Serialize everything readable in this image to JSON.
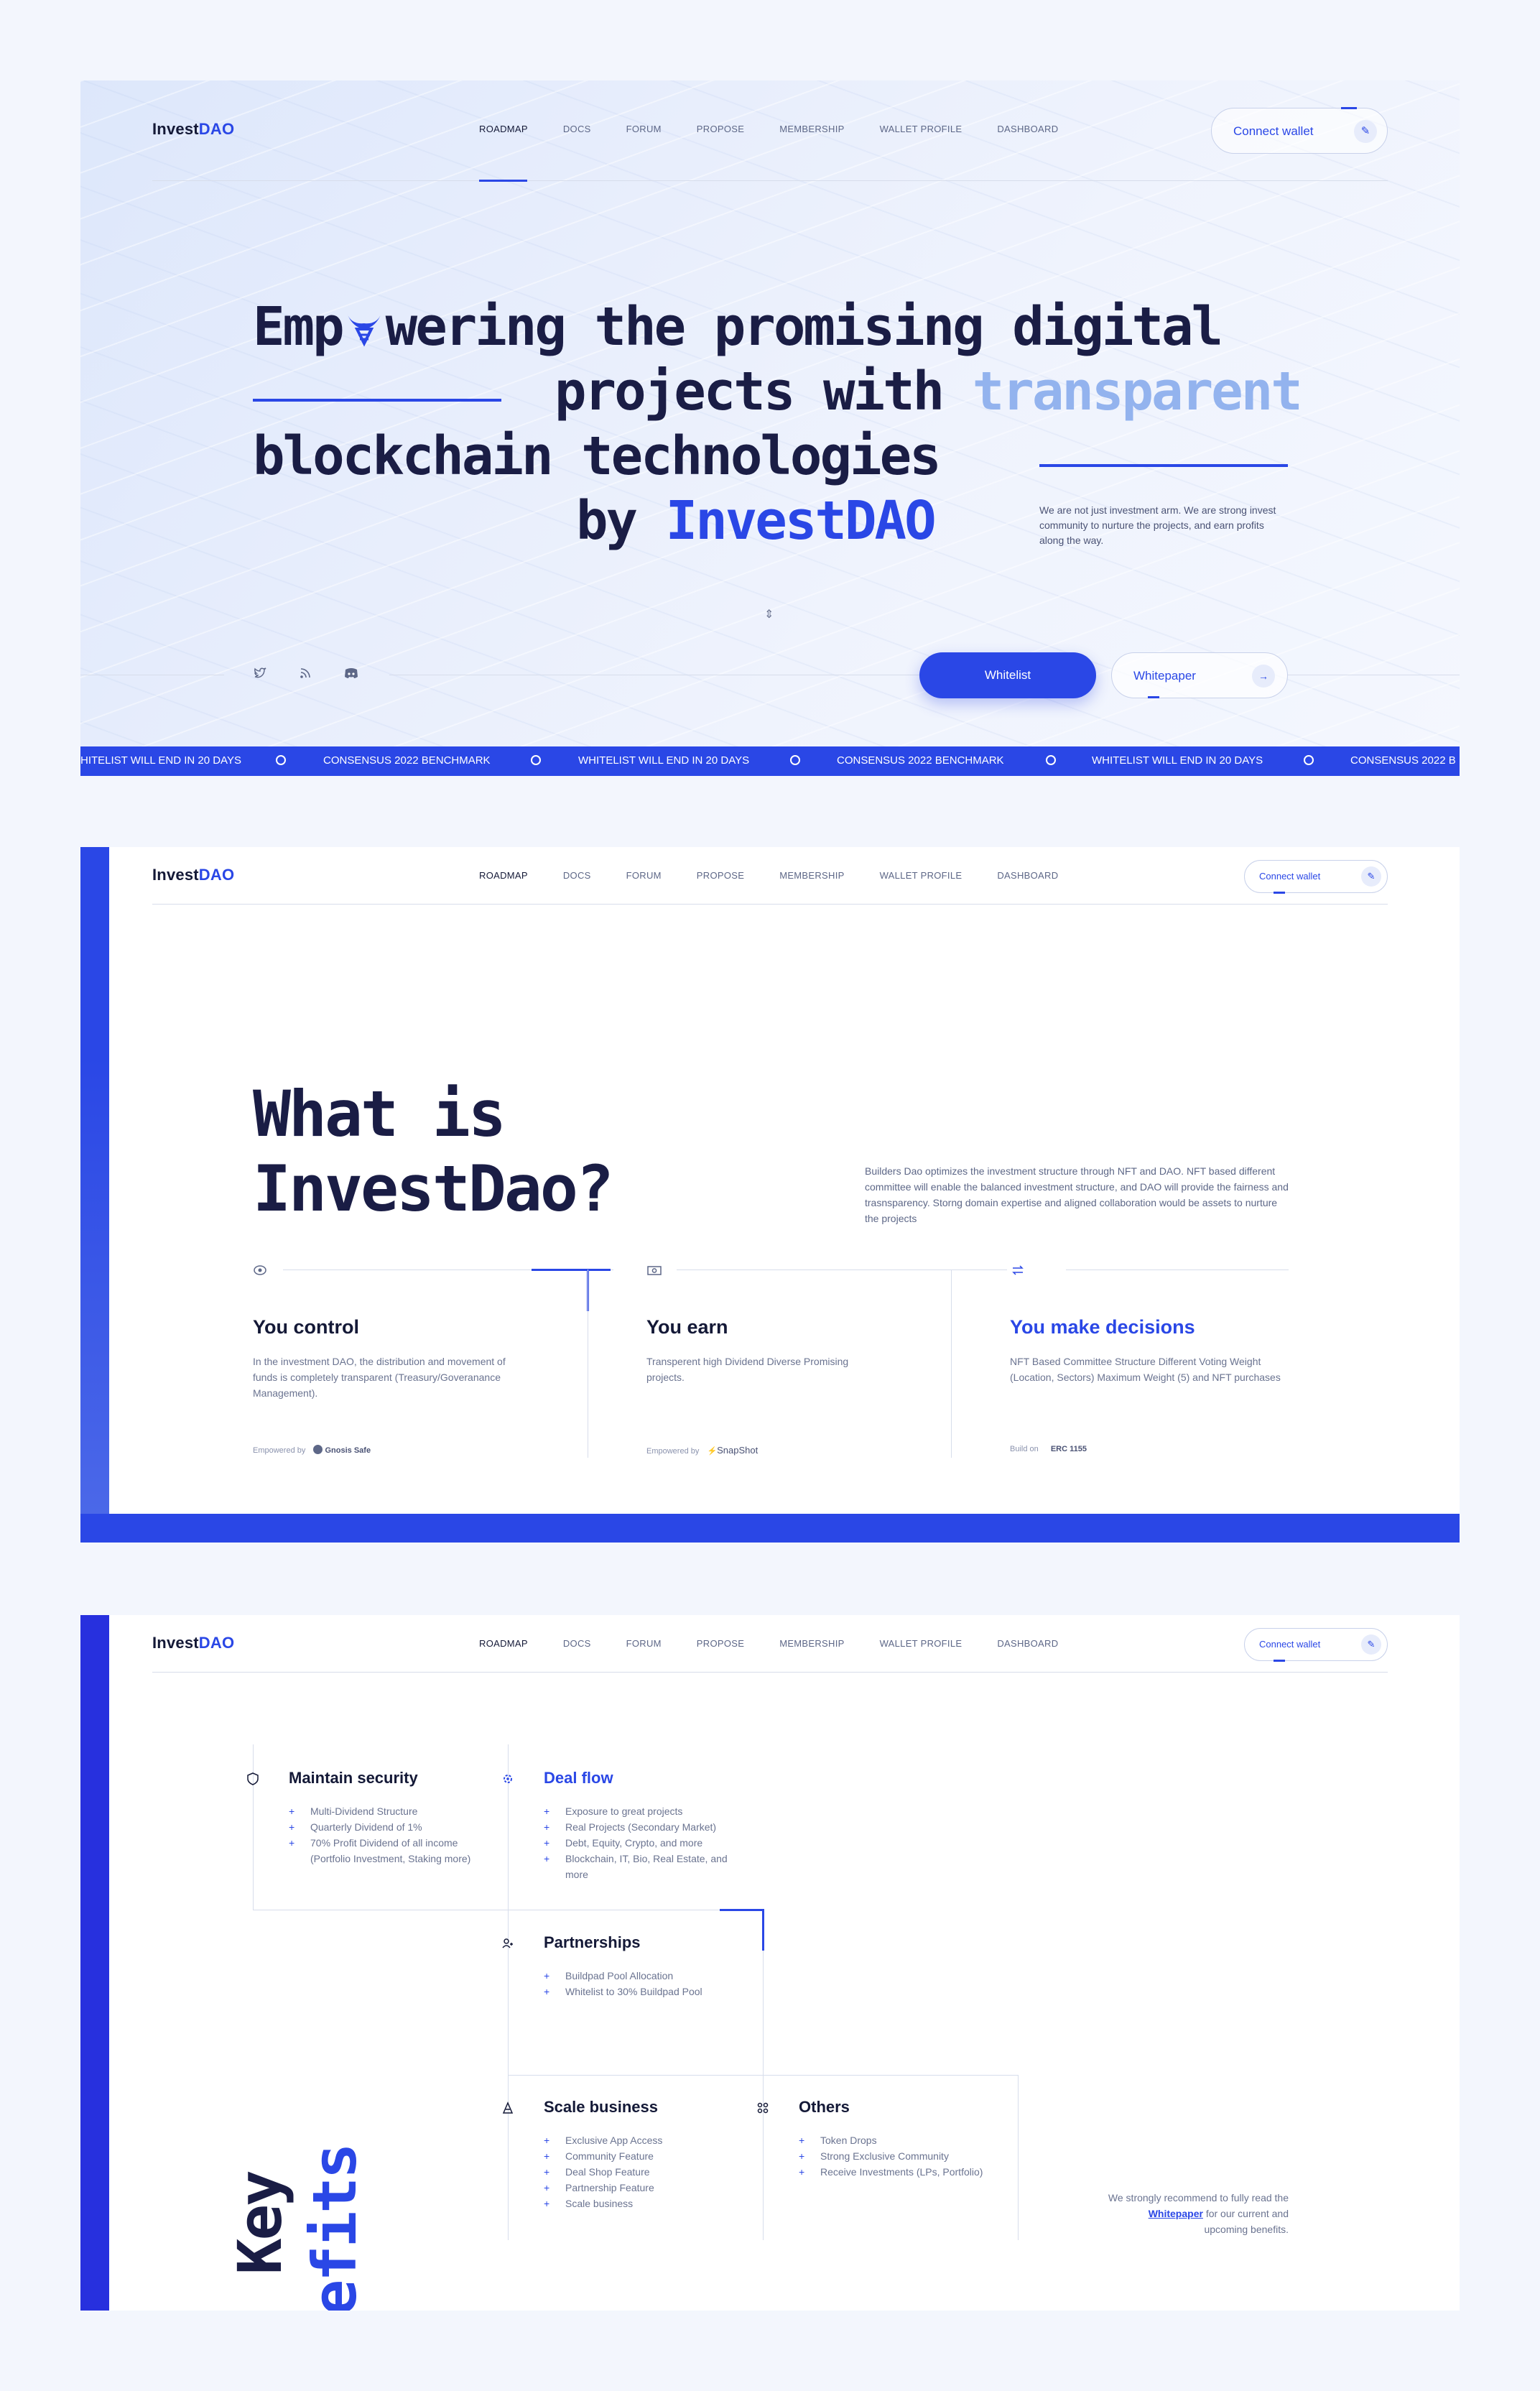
{
  "nav": {
    "logo_invest": "Invest",
    "logo_dao": "DAO",
    "items": [
      "ROADMAP",
      "DOCS",
      "FORUM",
      "PROPOSE",
      "MEMBERSHIP",
      "WALLET PROFILE",
      "DASHBOARD"
    ],
    "connect_label": "Connect wallet"
  },
  "hero": {
    "line1_a": "Emp",
    "line1_b": "wering the promising digital",
    "line2_a": "projects with ",
    "line2_b": "transparent",
    "line3": "blockchain technologies",
    "line4_a": "by ",
    "line4_b": "InvestDAO",
    "description": "We are not just investment arm. We are strong invest community to nurture the projects, and earn profits along the way.",
    "whitelist_label": "Whitelist",
    "whitepaper_label": "Whitepaper",
    "socials": [
      "twitter-icon",
      "rss-icon",
      "discord-icon"
    ]
  },
  "ticker": {
    "items": [
      "HITELIST WILL END IN 20 DAYS",
      "CONSENSUS 2022 BENCHMARK",
      "WHITELIST WILL END IN 20 DAYS",
      "CONSENSUS 2022 BENCHMARK",
      "WHITELIST WILL END IN 20 DAYS",
      "CONSENSUS 2022 BENCHMARK",
      "WHITELIST WILL END IN 20 DAYS",
      "CONSENSUS 2022 B"
    ]
  },
  "what": {
    "title_1": "What is",
    "title_2": "InvestDao?",
    "description": "Builders Dao optimizes the investment structure through NFT and DAO. NFT based different committee will enable the balanced investment structure, and DAO will provide the fairness and trasnsparency. Storng domain expertise and aligned collaboration would be assets to nurture the projects",
    "features": [
      {
        "title": "You control",
        "body": "In the investment DAO, the distribution and movement of funds is completely transparent (Treasury/Goveranance Management).",
        "foot_prefix": "Empowered by",
        "foot_brand": "Gnosis Safe"
      },
      {
        "title": "You earn",
        "body": "Transperent high Dividend Diverse Promising projects.",
        "foot_prefix": "Empowered by",
        "foot_brand": "SnapShot"
      },
      {
        "title": "You make decisions",
        "body": "NFT Based Committee Structure Different Voting Weight (Location, Sectors) Maximum Weight (5) and NFT purchases",
        "foot_prefix": "Build on",
        "foot_brand": "ERC 1155"
      }
    ]
  },
  "benefits": {
    "title_1": "Key",
    "title_2": "benefits",
    "cards": [
      {
        "title": "Maintain security",
        "items": [
          "Multi-Dividend Structure",
          "Quarterly Dividend of  1%",
          "70% Profit Dividend of all income (Portfolio Investment, Staking more)"
        ]
      },
      {
        "title": "Deal flow",
        "items": [
          "Exposure to great projects",
          "Real Projects (Secondary Market)",
          "Debt, Equity, Crypto, and more",
          "Blockchain, IT, Bio, Real Estate, and more"
        ]
      },
      {
        "title": "Partnerships",
        "items": [
          "Buildpad Pool Allocation",
          "Whitelist to 30% Buildpad Pool"
        ]
      },
      {
        "title": "Scale business",
        "items": [
          "Exclusive App Access",
          "Community Feature",
          "Deal Shop Feature",
          "Partnership Feature",
          "Scale business"
        ]
      },
      {
        "title": "Others",
        "items": [
          "Token Drops",
          "Strong Exclusive Community",
          "Receive Investments (LPs, Portfolio)"
        ]
      }
    ],
    "note_1": "We strongly recommend to fully read  the ",
    "note_link": "Whitepaper",
    "note_2": " for our current and upcoming benefits."
  },
  "colors": {
    "accent": "#2a47e6",
    "accent_light": "#93b3ee",
    "dark": "#141937"
  }
}
